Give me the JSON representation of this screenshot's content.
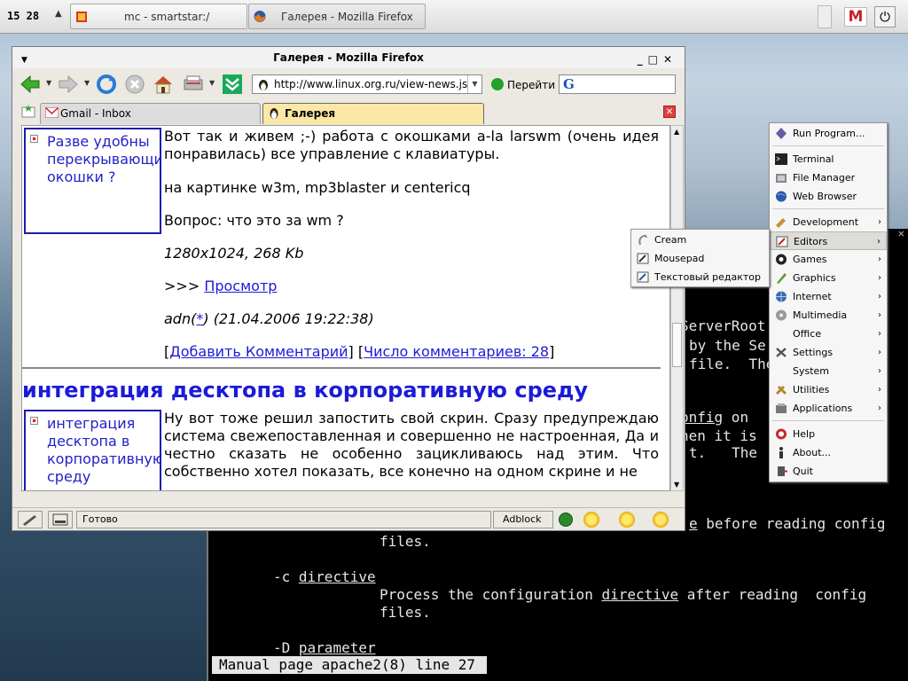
{
  "taskbar": {
    "clock": "15 28",
    "tasks": [
      {
        "label": "mc - smartstar:/"
      },
      {
        "label": "Галерея - Mozilla Firefox"
      }
    ]
  },
  "firefox": {
    "title": "Галерея - Mozilla Firefox",
    "url": "http://www.linux.org.ru/view-news.js",
    "go_label": "Перейти",
    "tabs": [
      {
        "label": "Gmail - Inbox",
        "active": false
      },
      {
        "label": "Галерея",
        "active": true
      }
    ],
    "status_text": "Готово",
    "adblock_label": "Adblock",
    "page": {
      "post1": {
        "side_link": "Разве удобны перекрывающиеся окошки ?",
        "text1": "Вот так и живем ;-) работа с окошками a-la larswm (очень идея понравилась) все управление с клавиатуры.",
        "text2": "на картинке w3m, mp3blaster и centericq",
        "text3": "Вопрос: что это за wm ?",
        "size": "1280x1024, 268 Kb",
        "view_prefix": ">>> ",
        "view_link": "Просмотр",
        "author": "adn",
        "author_star": "*",
        "date": "(21.04.2006 19:22:38)",
        "add_comment": "Добавить Комментарий",
        "comments_count": "Число комментариев: 28"
      },
      "post2": {
        "heading": "интеграция десктопа в корпоративную среду",
        "side_link": "интеграция десктопа в корпоративную среду",
        "text": "Ну вот тоже решил запостить свой скрин. Сразу предупреждаю система свежепоставленная и совершенно не настроенная, Да и честно сказать не особенно зацикливаюсь над этим. Что собственно хотел показать, все конечно на одном скрине и не"
      }
    }
  },
  "app_menu": {
    "items": [
      {
        "label": "Run Program...",
        "icon": "run-icon"
      },
      {
        "label": "Terminal",
        "icon": "terminal-icon"
      },
      {
        "label": "File Manager",
        "icon": "file-manager-icon"
      },
      {
        "label": "Web Browser",
        "icon": "globe-icon"
      },
      {
        "label": "Development",
        "icon": "development-icon",
        "submenu": true
      },
      {
        "label": "Editors",
        "icon": "editors-icon",
        "submenu": true,
        "selected": true
      },
      {
        "label": "Games",
        "icon": "games-icon",
        "submenu": true
      },
      {
        "label": "Graphics",
        "icon": "graphics-icon",
        "submenu": true
      },
      {
        "label": "Internet",
        "icon": "internet-icon",
        "submenu": true
      },
      {
        "label": "Multimedia",
        "icon": "multimedia-icon",
        "submenu": true
      },
      {
        "label": "Office",
        "icon": "office-icon",
        "submenu": true
      },
      {
        "label": "Settings",
        "icon": "settings-icon",
        "submenu": true
      },
      {
        "label": "System",
        "icon": "system-icon",
        "submenu": true
      },
      {
        "label": "Utilities",
        "icon": "utilities-icon",
        "submenu": true
      },
      {
        "label": "Applications",
        "icon": "applications-icon",
        "submenu": true
      },
      {
        "label": "Help",
        "icon": "help-icon"
      },
      {
        "label": "About...",
        "icon": "about-icon"
      },
      {
        "label": "Quit",
        "icon": "quit-icon"
      }
    ],
    "submenu_editors": [
      {
        "label": "Cream",
        "icon": "cream-icon"
      },
      {
        "label": "Mousepad",
        "icon": "mousepad-icon"
      },
      {
        "label": "Текстовый редактор",
        "icon": "text-editor-icon"
      }
    ]
  },
  "terminal": {
    "lines": {
      "l1": "ServerRoot",
      "l2": "by the Se",
      "l3": "file.  The",
      "l4a": "onfig",
      "l4b": " on",
      "l5": "hen it is",
      "l6": "t.   The",
      "l7a": "e",
      "l7b": " before reading config",
      "l8": "files.",
      "l9a": "-c ",
      "l9b": "directive",
      "l10a": "Process the configuration ",
      "l10b": "directive",
      "l10c": " after reading  config",
      "l11": "files.",
      "l12a": "-D ",
      "l12b": "parameter"
    },
    "status": "Manual page apache2(8) line 27"
  }
}
